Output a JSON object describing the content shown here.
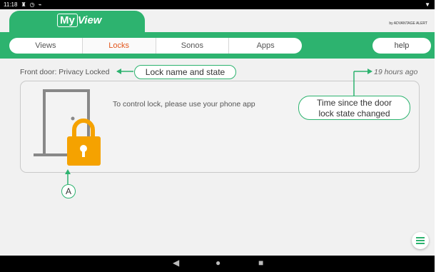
{
  "status": {
    "time": "11:18",
    "icons": [
      "notification-icon",
      "alarm-icon",
      "signal-icon"
    ],
    "right_icon": "wifi-icon"
  },
  "app": {
    "logo_text": "View",
    "logo_box": "My",
    "brand": "by ADVANTAGE ALERT"
  },
  "tabs": [
    "Views",
    "Locks",
    "Sonos",
    "Apps"
  ],
  "active_tab": "Locks",
  "help_label": "help",
  "lock": {
    "label": "Front door:",
    "state": "Privacy Locked",
    "time_ago": "19 hours ago",
    "message": "To control lock, please use your phone app"
  },
  "annotations": {
    "lock_name": "Lock name and state",
    "time_line1": "Time since the door",
    "time_line2": "lock state changed",
    "marker": "A"
  },
  "colors": {
    "accent": "#2db36f",
    "active_tab": "#e2561c",
    "lock_icon": "#f5a200"
  }
}
